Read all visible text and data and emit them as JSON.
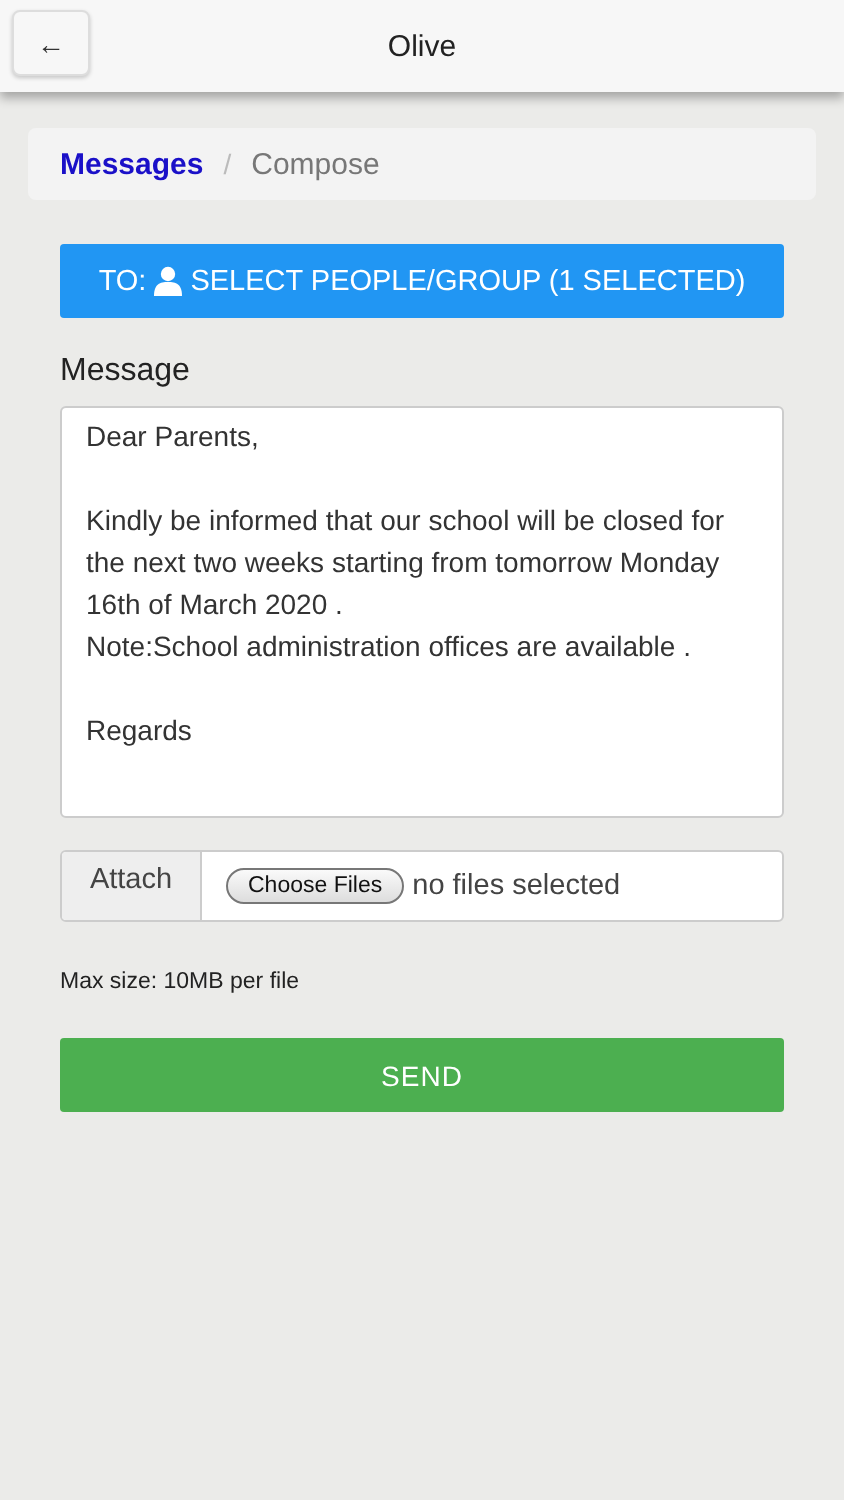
{
  "header": {
    "back_icon_text": "←",
    "title": "Olive"
  },
  "breadcrumb": [
    {
      "label": "Messages",
      "kind": "link"
    },
    {
      "label": "Compose",
      "kind": "current"
    }
  ],
  "breadcrumb_separator": "/",
  "recipient_button": {
    "prefix": "TO:",
    "label": "SELECT PEOPLE/GROUP (1 SELECTED)"
  },
  "message": {
    "label": "Message",
    "value": "Dear Parents,\n\nKindly be informed that our school will be closed for the next two weeks starting from tomorrow Monday 16th of March 2020 .\nNote:School administration offices are available .\n\nRegards"
  },
  "attach": {
    "label": "Attach",
    "button": "Choose Files",
    "status": "no files selected"
  },
  "max_size_note": "Max size: 10MB per file",
  "send_button": "SEND"
}
